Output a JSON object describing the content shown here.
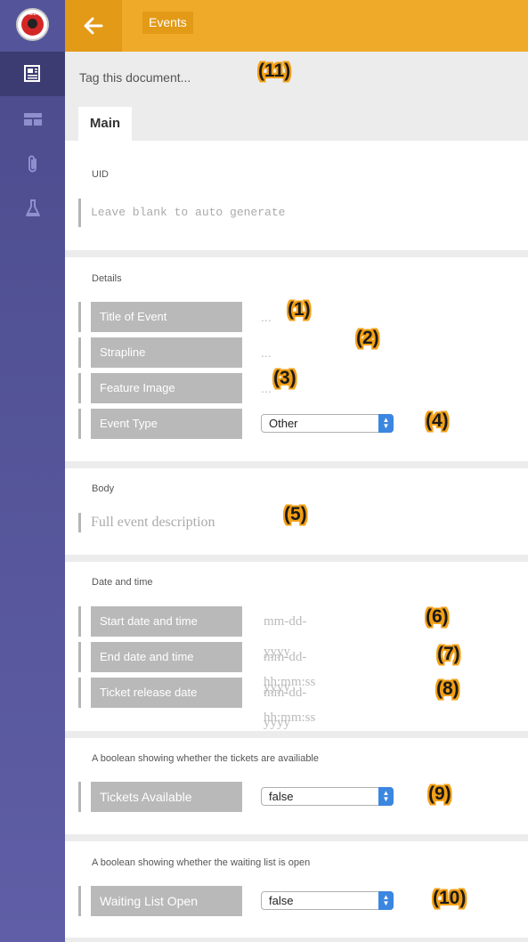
{
  "header": {
    "breadcrumb": "Events",
    "back_icon": "arrow-left-icon"
  },
  "sidebar": {
    "logo_text": "RED",
    "items": [
      {
        "icon": "document-icon",
        "active": true
      },
      {
        "icon": "layout-icon",
        "active": false
      },
      {
        "icon": "paperclip-icon",
        "active": false
      },
      {
        "icon": "flask-icon",
        "active": false
      }
    ]
  },
  "tags": {
    "placeholder": "Tag this document..."
  },
  "tabs": [
    {
      "label": "Main"
    }
  ],
  "uid": {
    "title": "UID",
    "placeholder": "Leave blank to auto generate"
  },
  "details": {
    "title": "Details",
    "fields": [
      {
        "label": "Title of Event",
        "value": "..."
      },
      {
        "label": "Strapline",
        "value": "..."
      },
      {
        "label": "Feature Image",
        "value": "..."
      },
      {
        "label": "Event Type",
        "select": "Other"
      }
    ]
  },
  "body": {
    "title": "Body",
    "placeholder": "Full event description"
  },
  "datetime": {
    "title": "Date and time",
    "fields": [
      {
        "label": "Start date and time",
        "placeholder": "mm-dd-yyyy hh:mm:ss"
      },
      {
        "label": "End date and time",
        "placeholder": "mm-dd-yyyy hh:mm:ss"
      },
      {
        "label": "Ticket release date",
        "placeholder": "mm-dd-yyyy hh:mm:ss"
      }
    ]
  },
  "tickets": {
    "title": "A boolean showing whether the tickets are availiable",
    "label": "Tickets Available",
    "select": "false"
  },
  "waiting": {
    "title": "A boolean showing whether the waiting list is open",
    "label": "Waiting List Open",
    "select": "false"
  },
  "annotations": [
    "(1)",
    "(2)",
    "(3)",
    "(4)",
    "(5)",
    "(6)",
    "(7)",
    "(8)",
    "(9)",
    "(10)",
    "(11)"
  ]
}
